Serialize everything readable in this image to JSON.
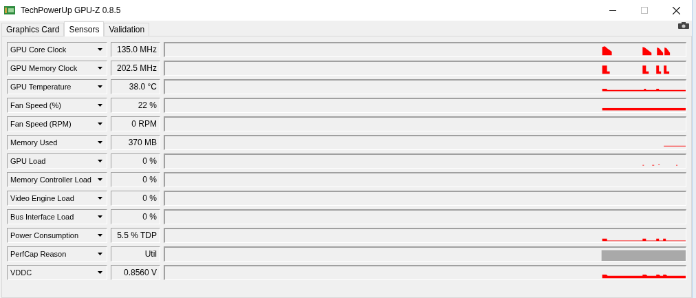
{
  "window": {
    "title": "TechPowerUp GPU-Z 0.8.5"
  },
  "tabs": [
    {
      "label": "Graphics Card",
      "selected": false
    },
    {
      "label": "Sensors",
      "selected": true
    },
    {
      "label": "Validation",
      "selected": false
    }
  ],
  "sensors": [
    {
      "name": "GPU Core Clock",
      "value": "135.0 MHz",
      "kind": "spikes"
    },
    {
      "name": "GPU Memory Clock",
      "value": "202.5 MHz",
      "kind": "blocks"
    },
    {
      "name": "GPU Temperature",
      "value": "38.0 °C",
      "kind": "thick-line"
    },
    {
      "name": "Fan Speed (%)",
      "value": "22 %",
      "kind": "flat-line"
    },
    {
      "name": "Fan Speed (RPM)",
      "value": "0 RPM",
      "kind": "empty"
    },
    {
      "name": "Memory Used",
      "value": "370 MB",
      "kind": "thin-line"
    },
    {
      "name": "GPU Load",
      "value": "0 %",
      "kind": "dots"
    },
    {
      "name": "Memory Controller Load",
      "value": "0 %",
      "kind": "empty"
    },
    {
      "name": "Video Engine Load",
      "value": "0 %",
      "kind": "empty"
    },
    {
      "name": "Bus Interface Load",
      "value": "0 %",
      "kind": "empty"
    },
    {
      "name": "Power Consumption",
      "value": "5.5 % TDP",
      "kind": "bumps"
    },
    {
      "name": "PerfCap Reason",
      "value": "Util",
      "kind": "gray-bar"
    },
    {
      "name": "VDDC",
      "value": "0.8560 V",
      "kind": "thick-bumps"
    }
  ]
}
